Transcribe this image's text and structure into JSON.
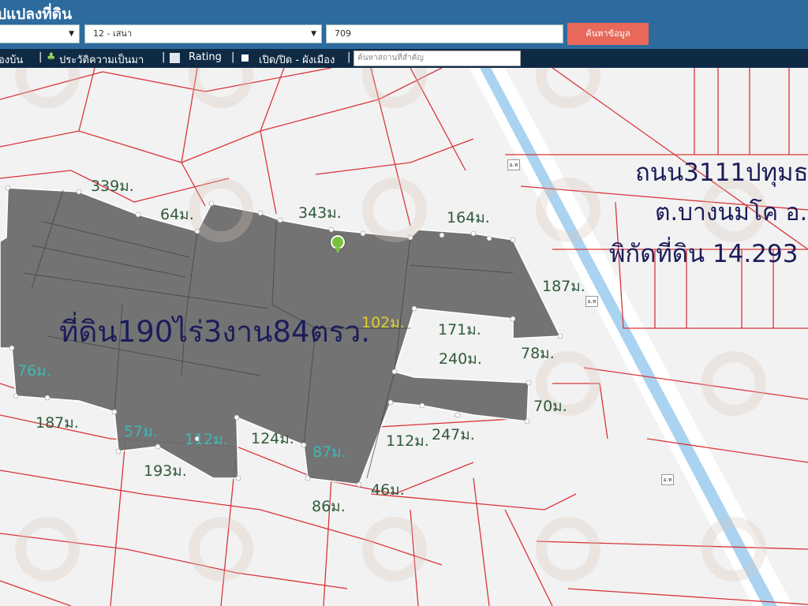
{
  "header": {
    "title": "ปแปลงที่ดิน",
    "district_select": "12 - เสนา",
    "parcel_number": "709",
    "search_button": "ค้นหาข้อมูล"
  },
  "toolbar": {
    "item1": "องบ้น",
    "item2": "ประวัติความเป็นมา",
    "item3": "Rating",
    "item4": "เปิด/ปิด - ผังเมือง",
    "search_placeholder": "ค้นหาสถานที่สำคัญ",
    "separator": "|"
  },
  "map": {
    "area_label": "ที่ดิน190ไร่3งาน84ตรว.",
    "road_line": "ถนน3111ปทุมธ",
    "subdistrict_line": "ต.บางนมโค อ.",
    "coord_line": "พิกัดที่ดิน 14.293",
    "road_marker_text": "อ.ท",
    "measures": [
      {
        "id": "m339",
        "text": "339ม."
      },
      {
        "id": "m64",
        "text": "64ม."
      },
      {
        "id": "m343",
        "text": "343ม."
      },
      {
        "id": "m164",
        "text": "164ม."
      },
      {
        "id": "m187a",
        "text": "187ม."
      },
      {
        "id": "m102",
        "text": "102ม."
      },
      {
        "id": "m171",
        "text": "171ม."
      },
      {
        "id": "m240",
        "text": "240ม."
      },
      {
        "id": "m78",
        "text": "78ม."
      },
      {
        "id": "m70",
        "text": "70ม."
      },
      {
        "id": "m247",
        "text": "247ม."
      },
      {
        "id": "m112a",
        "text": "112ม."
      },
      {
        "id": "m124",
        "text": "124ม."
      },
      {
        "id": "m87",
        "text": "87ม."
      },
      {
        "id": "m112b",
        "text": "112ม."
      },
      {
        "id": "m57",
        "text": "57ม."
      },
      {
        "id": "m187b",
        "text": "187ม."
      },
      {
        "id": "m76",
        "text": "76ม."
      },
      {
        "id": "m193",
        "text": "193ม."
      },
      {
        "id": "m86",
        "text": "86ม."
      },
      {
        "id": "m46",
        "text": "46ม."
      }
    ]
  },
  "colors": {
    "header_bg": "#2d6b9f",
    "toolbar_bg": "#0f2a44",
    "search_button": "#e8685a",
    "parcel_fill": "#6e6e6e",
    "parcel_boundary": "#d9353a",
    "canal": "#a9d3f0"
  }
}
